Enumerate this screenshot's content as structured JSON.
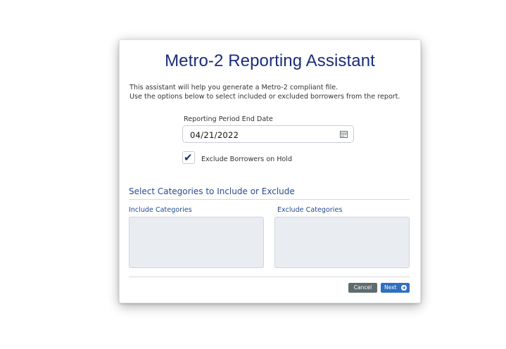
{
  "dialog": {
    "title": "Metro-2 Reporting Assistant",
    "intro_line1": "This assistant will help you generate a Metro-2 compliant file.",
    "intro_line2": "Use the options below to select included or excluded borrowers from the report."
  },
  "reporting_period": {
    "label": "Reporting Period End Date",
    "value": "04/21/2022",
    "icon": "calendar-icon"
  },
  "exclude_hold": {
    "label": "Exclude Borrowers on Hold",
    "checked": true,
    "check_glyph": "✔"
  },
  "categories": {
    "section_title": "Select Categories to Include or Exclude",
    "include_label": "Include Categories",
    "exclude_label": "Exclude Categories",
    "include_items": [],
    "exclude_items": []
  },
  "footer": {
    "cancel_label": "Cancel",
    "next_label": "Next",
    "next_icon": "arrow-right-circle-icon"
  },
  "colors": {
    "title": "#1b2d7a",
    "section": "#274b8f",
    "cancel_button": "#5e6c6e",
    "next_button": "#2f6fc0",
    "category_box": "#e9edf1"
  }
}
